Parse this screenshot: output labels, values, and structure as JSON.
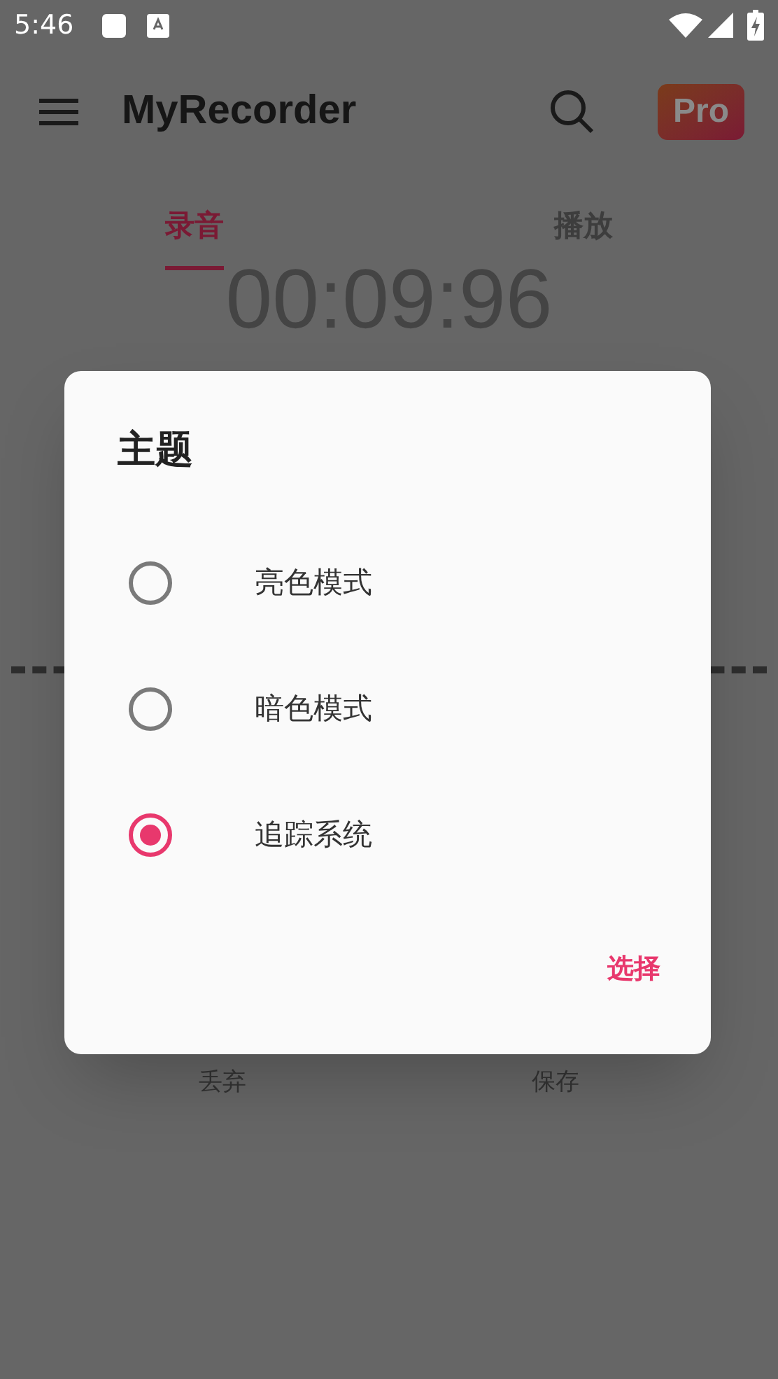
{
  "status_bar": {
    "time": "5:46"
  },
  "toolbar": {
    "title": "MyRecorder",
    "pro_badge": "Pro"
  },
  "tabs": [
    {
      "label": "录音",
      "selected": true
    },
    {
      "label": "播放",
      "selected": false
    }
  ],
  "timer": "00:09:96",
  "actions": [
    "丢弃",
    "保存"
  ],
  "dialog": {
    "title": "主题",
    "options": [
      {
        "label": "亮色模式",
        "selected": false
      },
      {
        "label": "暗色模式",
        "selected": false
      },
      {
        "label": "追踪系统",
        "selected": true
      }
    ],
    "confirm": "选择"
  }
}
